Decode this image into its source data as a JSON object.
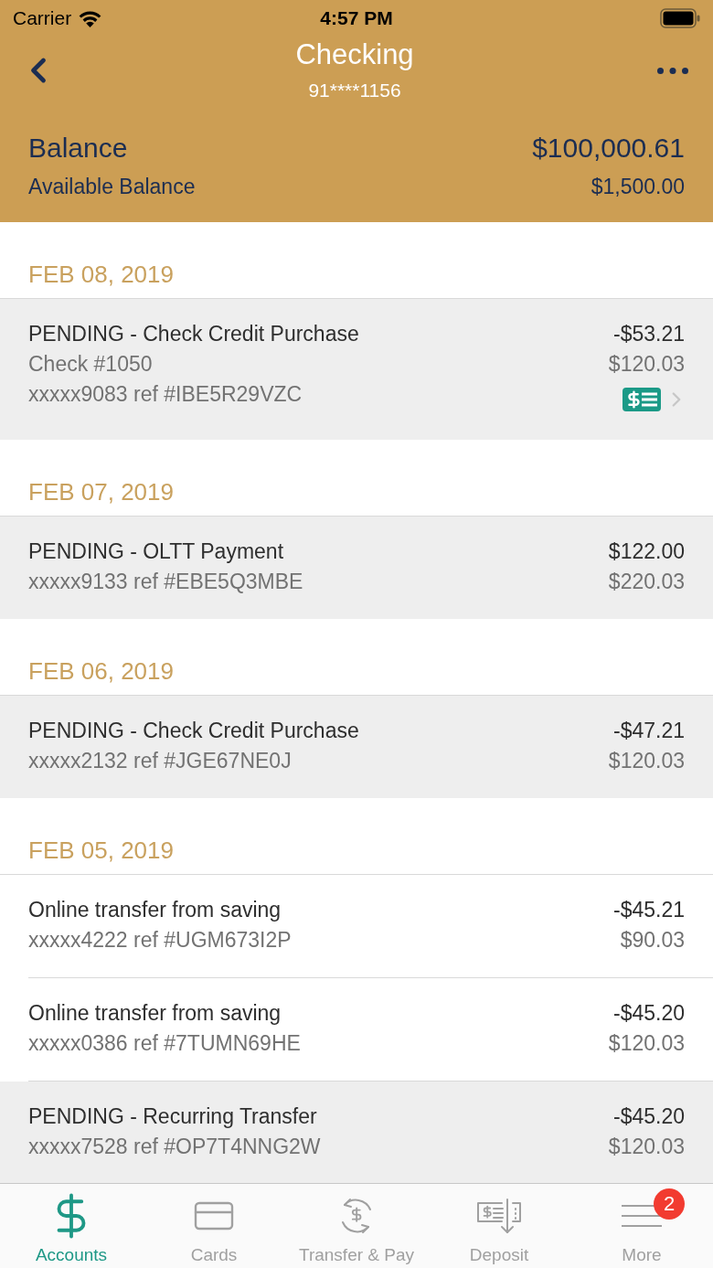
{
  "status_bar": {
    "carrier": "Carrier",
    "time": "4:57 PM"
  },
  "nav_bar": {
    "title": "Checking",
    "subtitle": "91****1156"
  },
  "balances": [
    {
      "label": "Balance",
      "amount": "$100,000.61",
      "kind": "primary"
    },
    {
      "label": "Available Balance",
      "amount": "$1,500.00",
      "kind": "secondary"
    }
  ],
  "sections": [
    {
      "date": "FEB 08, 2019",
      "transactions": [
        {
          "description": "PENDING - Check Credit Purchase",
          "details": [
            "Check #1050",
            "xxxxx9083 ref #IBE5R29VZC"
          ],
          "amount": "-$53.21",
          "running_balance": "$120.03",
          "pending": true,
          "check_image": true
        }
      ]
    },
    {
      "date": "FEB 07, 2019",
      "transactions": [
        {
          "description": "PENDING - OLTT Payment",
          "details": [
            "xxxxx9133 ref #EBE5Q3MBE"
          ],
          "amount": "$122.00",
          "running_balance": "$220.03",
          "pending": true,
          "check_image": false
        }
      ]
    },
    {
      "date": "FEB 06, 2019",
      "transactions": [
        {
          "description": "PENDING - Check Credit Purchase",
          "details": [
            "xxxxx2132 ref #JGE67NE0J"
          ],
          "amount": "-$47.21",
          "running_balance": "$120.03",
          "pending": true,
          "check_image": false
        }
      ]
    },
    {
      "date": "FEB 05, 2019",
      "transactions": [
        {
          "description": "Online transfer from saving",
          "details": [
            "xxxxx4222 ref #UGM673I2P"
          ],
          "amount": "-$45.21",
          "running_balance": "$90.03",
          "pending": false,
          "check_image": false
        },
        {
          "description": "Online transfer from saving",
          "details": [
            "xxxxx0386 ref #7TUMN69HE"
          ],
          "amount": "-$45.20",
          "running_balance": "$120.03",
          "pending": false,
          "check_image": false
        },
        {
          "description": "PENDING - Recurring Transfer",
          "details": [
            "xxxxx7528 ref #OP7T4NNG2W"
          ],
          "amount": "-$45.20",
          "running_balance": "$120.03",
          "pending": true,
          "check_image": false
        }
      ]
    }
  ],
  "tab_bar": [
    {
      "label": "Accounts",
      "selected": true
    },
    {
      "label": "Cards",
      "selected": false
    },
    {
      "label": "Transfer & Pay",
      "selected": false
    },
    {
      "label": "Deposit",
      "selected": false
    },
    {
      "label": "More",
      "selected": false,
      "badge": "2"
    }
  ]
}
